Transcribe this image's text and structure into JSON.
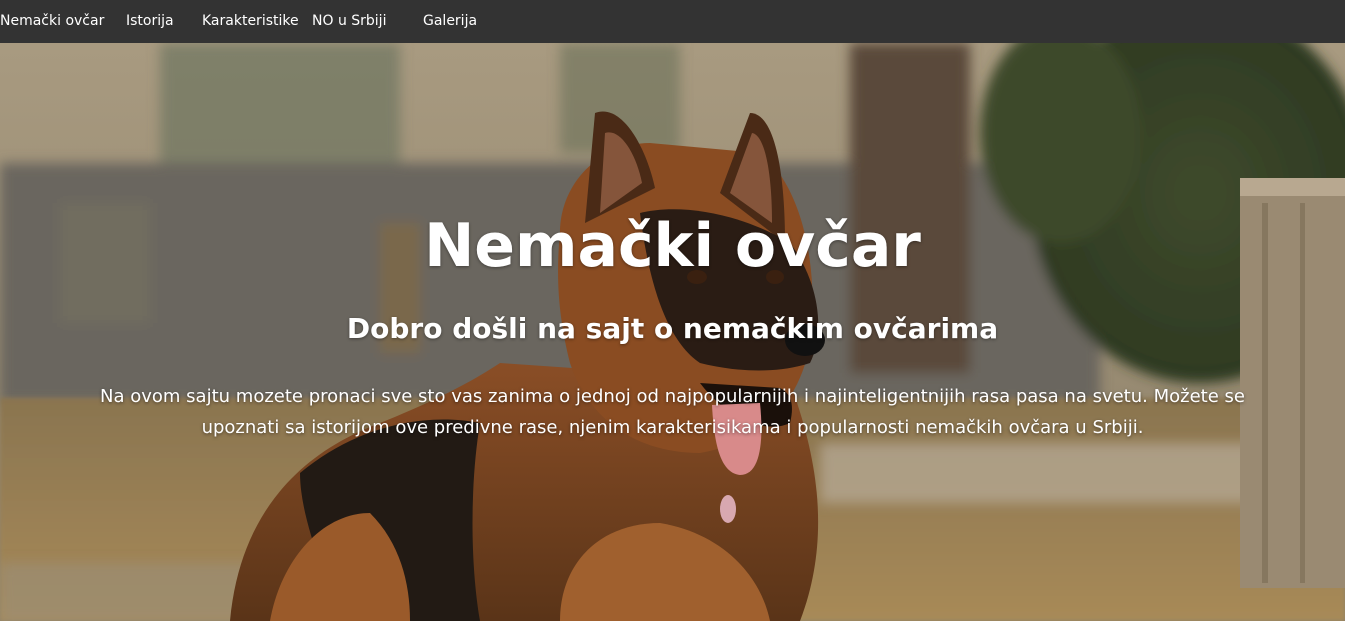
{
  "nav": {
    "items": [
      {
        "label": "Nemački ovčar"
      },
      {
        "label": "Istorija"
      },
      {
        "label": "Karakteristike"
      },
      {
        "label": "NO u Srbiji"
      },
      {
        "label": "Galerija"
      }
    ]
  },
  "hero": {
    "title": "Nemački ovčar",
    "subtitle": "Dobro došli na sajt o nemačkim ovčarima",
    "text": "Na ovom sajtu mozete pronaci sve sto vas zanima o jednoj od najpopularnijih i najinteligentnijih rasa pasa na svetu. Možete se upoznati sa istorijom ove predivne rase, njenim karakterisikama i popularnosti nemačkih ovčara u Srbiji.",
    "background": "german-shepherd-photo"
  },
  "colors": {
    "navbar": "#333333",
    "nav_text": "#ffffff",
    "hero_text": "#ffffff"
  }
}
